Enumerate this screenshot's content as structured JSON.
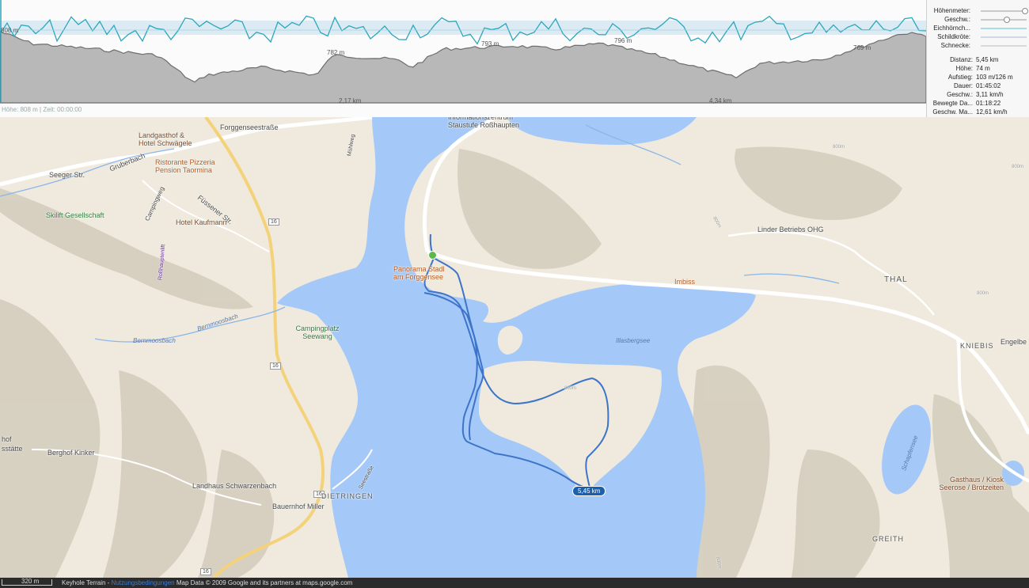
{
  "profile": {
    "elevation_label": "808 m",
    "peak_labels": [
      "782 m",
      "793 m",
      "796 m",
      "769 m"
    ],
    "distance_ticks": [
      "2,17 km",
      "4,34 km"
    ],
    "status_line": "Höhe: 808 m | Zeit: 00:00:00"
  },
  "legend": {
    "items": [
      {
        "label": "Höhenmeter:",
        "level": 1.0
      },
      {
        "label": "Geschw.:",
        "level": 0.55
      },
      {
        "label": "Eichhörnch...",
        "level": 0.0
      },
      {
        "label": "Schildkröte:",
        "level": 0.0
      },
      {
        "label": "Schnecke:",
        "level": 0.0
      }
    ],
    "stats": [
      {
        "label": "Distanz:",
        "value": "5,45 km"
      },
      {
        "label": "Höhe:",
        "value": "74 m"
      },
      {
        "label": "Aufstieg:",
        "value": "103 m/126 m"
      },
      {
        "label": "Dauer:",
        "value": "01:45:02"
      },
      {
        "label": "Geschw.:",
        "value": "3,11 km/h"
      },
      {
        "label": "Bewegte Da...",
        "value": "01:18:22"
      },
      {
        "label": "Geschw. Ma...",
        "value": "12,61 km/h"
      }
    ]
  },
  "map": {
    "roads": [
      "Forggenseestraße",
      "Seeger Str.",
      "Gruberbach",
      "Füssener Str.",
      "Campingweg",
      "Bernmoosbach",
      "Bernmoosbach",
      "Seestraße",
      "Mühlweg",
      "Roßhauptenlift"
    ],
    "route_numbers": [
      "16",
      "16",
      "16",
      "16"
    ],
    "pois": {
      "landgasthof": "Landgasthof & Hotel Schwägele",
      "pizzeria": "Ristorante Pizzeria Pension Taormina",
      "skilift": "Skilift Gesellschaft",
      "kaufmann": "Hotel Kaufmann",
      "camping": "Campingplatz Seewang",
      "berghof": "Berghof Kinker",
      "schwarzenbach": "Landhaus Schwarzenbach",
      "bauernhof": "Bauernhof Miller",
      "info": "Informationszentrum Staustufe Roßhaupten",
      "panorama": "Panorama Stadl am Forggensee",
      "imbiss": "Imbiss",
      "linder": "Linder Betriebs OHG",
      "engelbe": "Engelbe",
      "kiosk": "Gasthaus / Kiosk Seerose / Brotzeiten",
      "hof_partial": "hof",
      "staette_partial": "sstätte"
    },
    "towns": [
      "THAL",
      "KNIEBIS",
      "DIETRINGEN",
      "GREITH"
    ],
    "lakes": [
      "Illasbergsee",
      "Schapfensee"
    ],
    "contours": [
      "800m",
      "800m",
      "800m",
      "800m",
      "800m",
      "800m"
    ],
    "distance_badge": "5,45 km"
  },
  "footer": {
    "scale": "320 m",
    "layer": "Keyhole Terrain - ",
    "link": "Nutzungsbedingungen",
    "credit": " Map Data © 2009 Google and its partners at maps.google.com"
  },
  "colors": {
    "water": "#a4c9f8",
    "land": "#efeadd",
    "route": "#3d74c9",
    "speed_line": "#2aa7bd",
    "elevation_fill": "#b7b7b7"
  }
}
